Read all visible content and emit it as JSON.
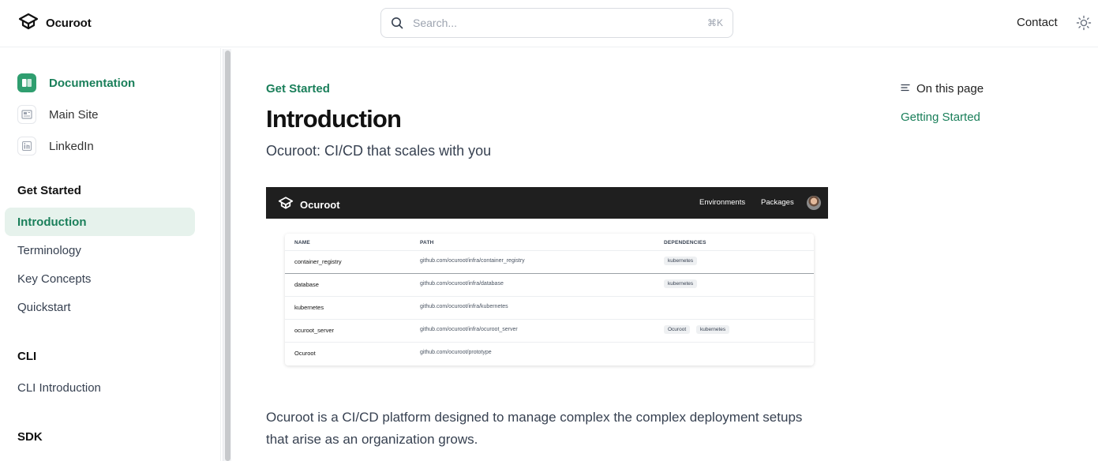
{
  "header": {
    "brand": "Ocuroot",
    "search_placeholder": "Search...",
    "search_shortcut": "⌘K",
    "contact_label": "Contact",
    "icons": {
      "logo": "ocuroot-logo-icon",
      "search": "search-icon",
      "theme": "sun-icon"
    }
  },
  "sidebar": {
    "anchors": [
      {
        "label": "Documentation",
        "icon": "book-icon",
        "active": true
      },
      {
        "label": "Main Site",
        "icon": "newspaper-icon",
        "active": false
      },
      {
        "label": "LinkedIn",
        "icon": "linkedin-icon",
        "active": false
      }
    ],
    "groups": [
      {
        "title": "Get Started",
        "items": [
          "Introduction",
          "Terminology",
          "Key Concepts",
          "Quickstart"
        ],
        "active": "Introduction"
      },
      {
        "title": "CLI",
        "items": [
          "CLI Introduction"
        ]
      },
      {
        "title": "SDK",
        "items": []
      }
    ]
  },
  "main": {
    "eyebrow": "Get Started",
    "title": "Introduction",
    "subtitle": "Ocuroot: CI/CD that scales with you",
    "body": "Ocuroot is a CI/CD platform designed to manage complex the complex deployment setups that arise as an organization grows.",
    "screenshot": {
      "brand": "Ocuroot",
      "nav": [
        "Environments",
        "Packages"
      ],
      "columns": [
        "NAME",
        "PATH",
        "DEPENDENCIES"
      ],
      "rows": [
        {
          "name": "container_registry",
          "path": "github.com/ocuroot/infra/container_registry",
          "deps": [
            "kubernetes"
          ]
        },
        {
          "name": "database",
          "path": "github.com/ocuroot/infra/database",
          "deps": [
            "kubernetes"
          ]
        },
        {
          "name": "kubernetes",
          "path": "github.com/ocuroot/infra/kubernetes",
          "deps": []
        },
        {
          "name": "ocuroot_server",
          "path": "github.com/ocuroot/infra/ocuroot_server",
          "deps": [
            "Ocuroot",
            "kubernetes"
          ]
        },
        {
          "name": "Ocuroot",
          "path": "github.com/ocuroot/prototype",
          "deps": []
        }
      ]
    }
  },
  "toc": {
    "heading": "On this page",
    "links": [
      "Getting Started"
    ]
  },
  "colors": {
    "accent": "#1a7f5a",
    "accent_bg": "#e6f2ec",
    "icon_green": "#2f9e6f",
    "screenshot_bar": "#1f1f1f"
  }
}
